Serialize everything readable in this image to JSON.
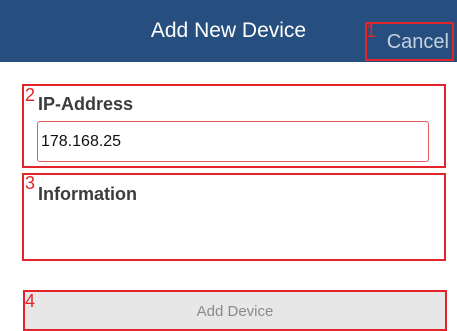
{
  "header": {
    "title": "Add New Device",
    "cancel_label": "Cancel"
  },
  "callouts": [
    "1",
    "2",
    "3",
    "4"
  ],
  "form": {
    "ip_label": "IP-Address",
    "ip_value": "178.168.25",
    "info_label": "Information",
    "info_value": "",
    "add_button_label": "Add Device"
  },
  "colors": {
    "header_bg": "#264e7e",
    "callout": "#e3242b",
    "button_bg": "#e7e7e7"
  }
}
